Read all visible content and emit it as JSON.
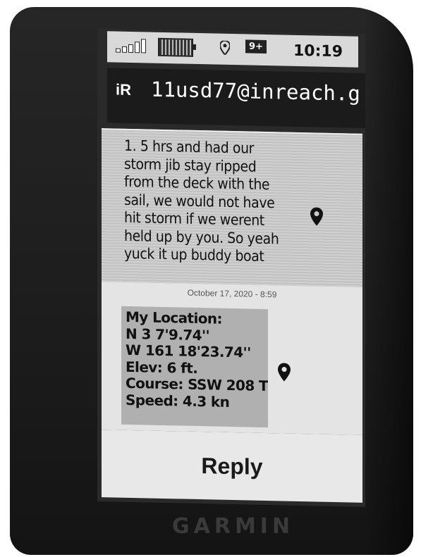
{
  "status_bar": {
    "signal_icon": "signal-bars-icon",
    "battery_icon": "battery-icon",
    "location_icon": "location-pin-icon",
    "message_badge": "9+",
    "time": "10:19"
  },
  "header": {
    "ir_logo": "iR",
    "address": "11usd77@inreach.g"
  },
  "incoming_message": {
    "lines": [
      "1. 5 hrs and had our",
      "storm jib stay ripped",
      "from the deck with the",
      "sail, we would not have",
      "hit storm if we werent",
      "held up by you. So yeah",
      "yuck it up buddy boat"
    ],
    "pin_icon": "map-pin-icon"
  },
  "outgoing_message": {
    "timestamp": "October 17, 2020 - 8:59",
    "lines": [
      "My Location:",
      "N 3 7'9.74''",
      "W 161 18'23.74''",
      "Elev: 6 ft.",
      "Course: SSW 208 T",
      "Speed: 4.3 kn"
    ],
    "pin_icon": "map-pin-icon"
  },
  "reply_label": "Reply",
  "brand": "GARMIN",
  "colors": {
    "device": "#1c1c1c",
    "header_bg": "#1b1b1b",
    "screen_bg": "#e4e4e4",
    "bubble_bg": "#b0b0b0"
  }
}
